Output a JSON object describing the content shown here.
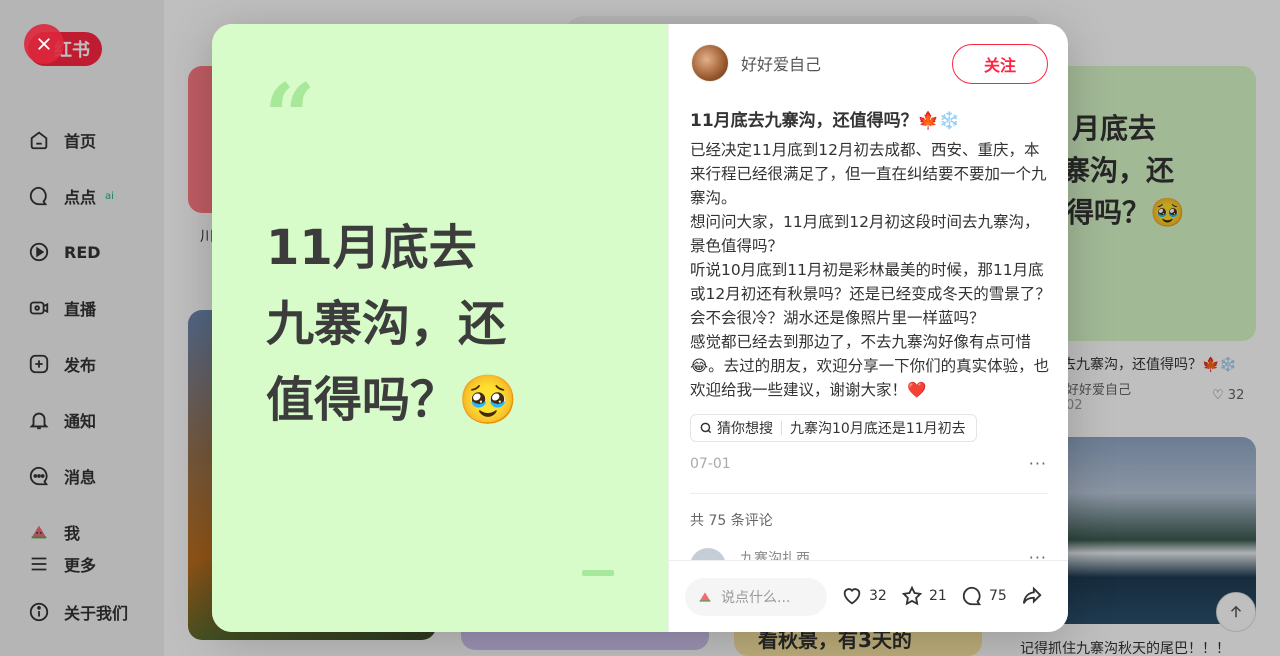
{
  "sidebar": {
    "logo_text": "红书",
    "items": [
      {
        "label": "首页",
        "icon": "home-icon"
      },
      {
        "label": "点点",
        "icon": "chat-bubble-icon",
        "badge": "ai"
      },
      {
        "label": "RED",
        "icon": "play-icon"
      },
      {
        "label": "直播",
        "icon": "live-icon"
      },
      {
        "label": "发布",
        "icon": "plus-square-icon"
      },
      {
        "label": "通知",
        "icon": "bell-icon"
      },
      {
        "label": "消息",
        "icon": "message-icon"
      },
      {
        "label": "我",
        "icon": "watermelon-avatar-icon"
      }
    ],
    "more": "更多",
    "about": "关于我们"
  },
  "feed": {
    "left_card_caption": "川",
    "right_card_title_lines": [
      "月底去",
      "寨沟，还",
      "得吗？🥹"
    ],
    "right_card_caption": "去九寨沟，还值得吗？🍁❄️",
    "right_card_author": "好好爱自己",
    "right_card_date": "02",
    "right_card_likes": "32",
    "yellow_card_text": "看秋景，有3天的",
    "lake_card_caption": "记得抓住九寨沟秋天的尾巴！！！"
  },
  "modal": {
    "cover": {
      "quote_mark": "“",
      "title_lines": [
        "11月底去",
        "九寨沟，还",
        "值得吗？🥹"
      ]
    },
    "author": {
      "name": "好好爱自己",
      "follow_label": "关注"
    },
    "note": {
      "title": "11月底去九寨沟，还值得吗？🍁❄️",
      "paragraphs": [
        "已经决定11月底到12月初去成都、西安、重庆，本来行程已经很满足了，但一直在纠结要不要加一个九寨沟。",
        "想问问大家，11月底到12月初这段时间去九寨沟，景色值得吗？",
        "听说10月底到11月初是彩林最美的时候，那11月底或12月初还有秋景吗？还是已经变成冬天的雪景了？会不会很冷？湖水还是像照片里一样蓝吗？",
        "感觉都已经去到那边了，不去九寨沟好像有点可惜😂。去过的朋友，欢迎分享一下你们的真实体验，也欢迎给我一些建议，谢谢大家！❤️"
      ],
      "search_hint_label": "猜你想搜",
      "search_hint_query": "九寨沟10月底还是11月初去",
      "date": "07-01",
      "more": "···"
    },
    "comments": {
      "count_text": "共 75 条评论",
      "first_commenter": "九寨沟扎西",
      "more": "···"
    },
    "bottom_bar": {
      "input_placeholder": "说点什么...",
      "likes": "32",
      "collects": "21",
      "comments": "75"
    }
  }
}
